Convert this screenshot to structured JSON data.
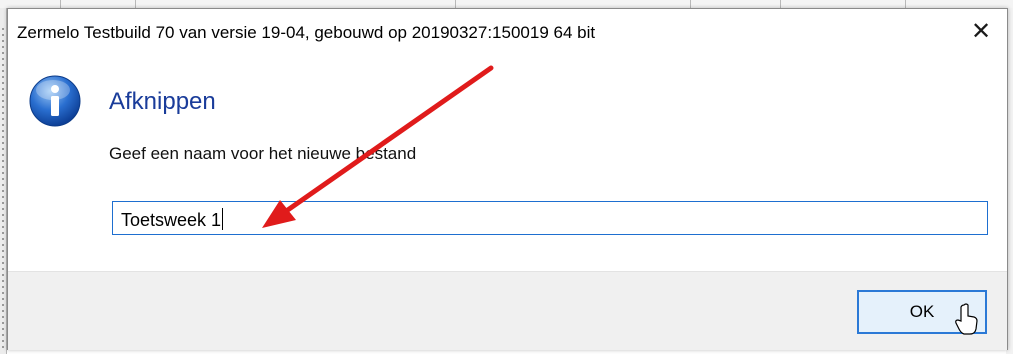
{
  "dialog": {
    "title": "Zermelo Testbuild 70 van versie 19-04, gebouwd op 20190327:150019 64 bit",
    "close_glyph": "✕",
    "heading": "Afknippen",
    "prompt": "Geef een naam voor het nieuwe bestand",
    "input_value": "Toetsweek 1",
    "ok_label": "OK",
    "icon": "info-icon",
    "accent_color": "#1a3c9a",
    "annotation_arrow_color": "#e01b1b"
  }
}
